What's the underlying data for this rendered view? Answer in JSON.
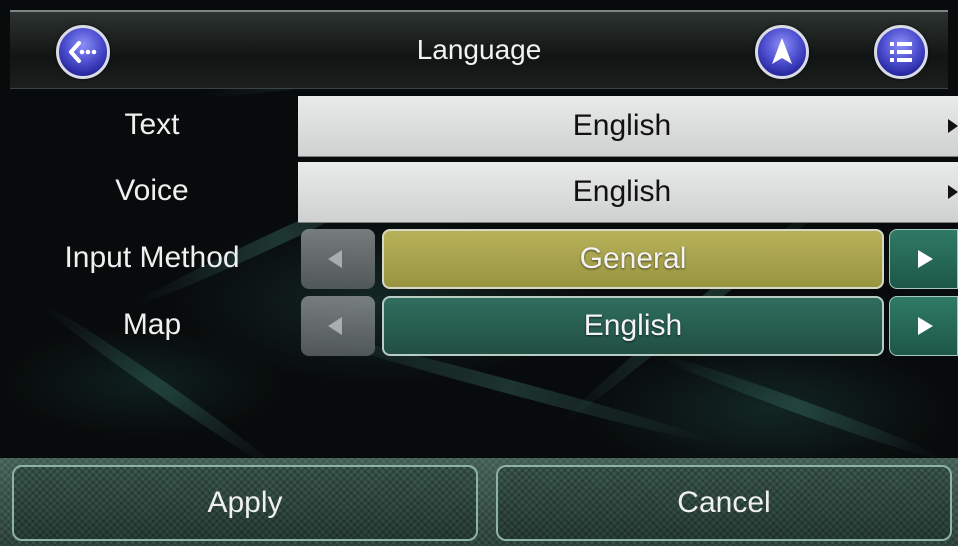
{
  "header": {
    "title": "Language",
    "back_icon": "back-icon",
    "navigate_icon": "navigation-arrow-icon",
    "menu_icon": "menu-list-icon"
  },
  "rows": [
    {
      "label": "Text",
      "value": "English",
      "style": "list"
    },
    {
      "label": "Voice",
      "value": "English",
      "style": "list"
    },
    {
      "label": "Input Method",
      "value": "General",
      "style": "stepper",
      "color": "#b0aa52"
    },
    {
      "label": "Map",
      "value": "English",
      "style": "stepper",
      "color": "#2a6152"
    }
  ],
  "footer": {
    "apply_label": "Apply",
    "cancel_label": "Cancel"
  },
  "colors": {
    "header_button_fill": "#4d4fcf",
    "accent_green": "#2f6e5e",
    "accent_yellow": "#b7b25a"
  }
}
